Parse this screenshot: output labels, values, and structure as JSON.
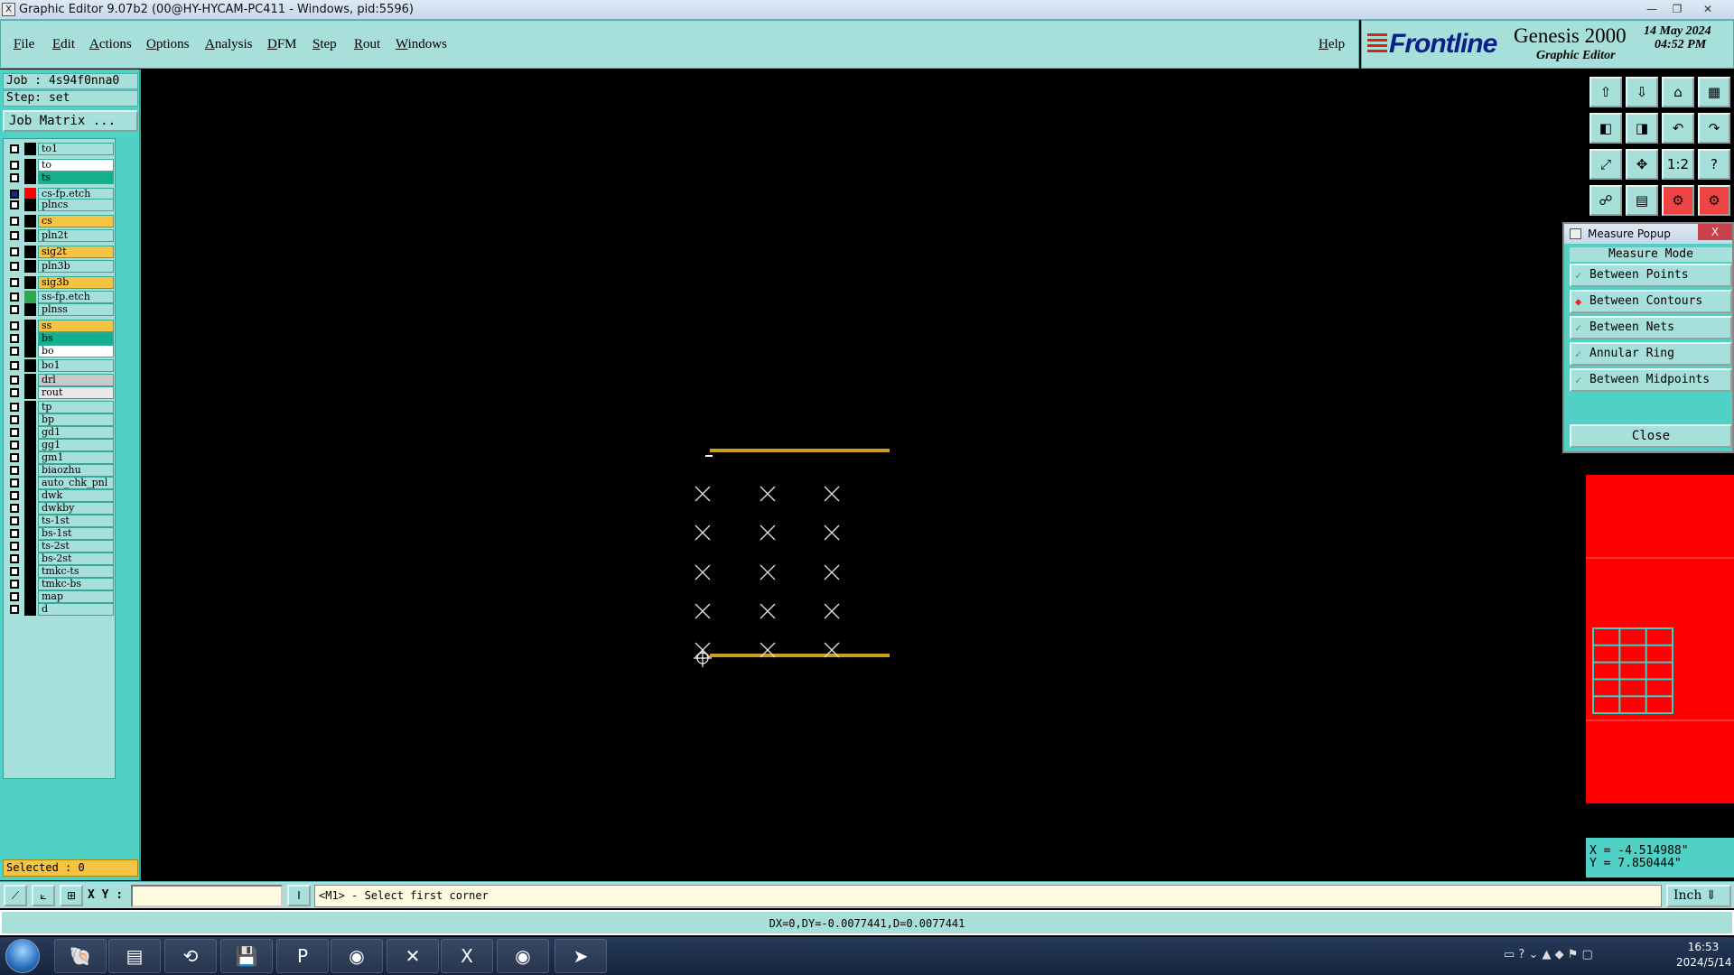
{
  "window": {
    "title": "Graphic Editor 9.07b2 (00@HY-HYCAM-PC411 - Windows, pid:5596)",
    "app_icon": "X"
  },
  "menu": {
    "items": [
      "File",
      "Edit",
      "Actions",
      "Options",
      "Analysis",
      "DFM",
      "Step",
      "Rout",
      "Windows"
    ],
    "help": "Help"
  },
  "brand": {
    "logo": "Frontline",
    "product": "Genesis 2000",
    "subtitle": "Graphic Editor",
    "date": "14 May 2024",
    "time": "04:52 PM"
  },
  "job": {
    "job_line": "Job : 4s94f0nna0",
    "step_line": "Step: set",
    "job_matrix_button": "Job Matrix ..."
  },
  "layers": [
    {
      "name": "to1",
      "color": "#a7dfdb",
      "swatch": "#000000"
    },
    {
      "name": "to",
      "color": "#ffffff",
      "swatch": "#000000"
    },
    {
      "name": "ts",
      "color": "#12b08c",
      "swatch": "#000000"
    },
    {
      "name": "cs-fp.etch",
      "color": "#a7dfdb",
      "swatch": "#ff0000",
      "marker": true
    },
    {
      "name": "plncs",
      "color": "#a7dfdb",
      "swatch": "#000000"
    },
    {
      "name": "cs",
      "color": "#f6c342",
      "swatch": "#000000"
    },
    {
      "name": "pln2t",
      "color": "#a7dfdb",
      "swatch": "#000000"
    },
    {
      "name": "sig2t",
      "color": "#f6c342",
      "swatch": "#000000"
    },
    {
      "name": "pln3b",
      "color": "#a7dfdb",
      "swatch": "#000000"
    },
    {
      "name": "sig3b",
      "color": "#f6c342",
      "swatch": "#000000"
    },
    {
      "name": "ss-fp.etch",
      "color": "#a7dfdb",
      "swatch": "#2fa84f"
    },
    {
      "name": "plnss",
      "color": "#a7dfdb",
      "swatch": "#000000"
    },
    {
      "name": "ss",
      "color": "#f6c342",
      "swatch": "#000000"
    },
    {
      "name": "bs",
      "color": "#12b08c",
      "swatch": "#000000"
    },
    {
      "name": "bo",
      "color": "#ffffff",
      "swatch": "#000000"
    },
    {
      "name": "bo1",
      "color": "#a7dfdb",
      "swatch": "#000000"
    },
    {
      "name": "drl",
      "color": "#c9c9c9",
      "swatch": "#000000"
    },
    {
      "name": "rout",
      "color": "#e8e8e8",
      "swatch": "#000000"
    },
    {
      "name": "tp",
      "color": "#a7dfdb",
      "swatch": "#000000"
    },
    {
      "name": "bp",
      "color": "#a7dfdb",
      "swatch": "#000000"
    },
    {
      "name": "gd1",
      "color": "#a7dfdb",
      "swatch": "#000000"
    },
    {
      "name": "gg1",
      "color": "#a7dfdb",
      "swatch": "#000000"
    },
    {
      "name": "gm1",
      "color": "#a7dfdb",
      "swatch": "#000000"
    },
    {
      "name": "biaozhu",
      "color": "#a7dfdb",
      "swatch": "#000000"
    },
    {
      "name": "auto_chk_pnl",
      "color": "#a7dfdb",
      "swatch": "#000000"
    },
    {
      "name": "dwk",
      "color": "#a7dfdb",
      "swatch": "#000000"
    },
    {
      "name": "dwkby",
      "color": "#a7dfdb",
      "swatch": "#000000"
    },
    {
      "name": "ts-1st",
      "color": "#a7dfdb",
      "swatch": "#000000"
    },
    {
      "name": "bs-1st",
      "color": "#a7dfdb",
      "swatch": "#000000"
    },
    {
      "name": "ts-2st",
      "color": "#a7dfdb",
      "swatch": "#000000"
    },
    {
      "name": "bs-2st",
      "color": "#a7dfdb",
      "swatch": "#000000"
    },
    {
      "name": "tmkc-ts",
      "color": "#a7dfdb",
      "swatch": "#000000"
    },
    {
      "name": "tmkc-bs",
      "color": "#a7dfdb",
      "swatch": "#000000"
    },
    {
      "name": "map",
      "color": "#a7dfdb",
      "swatch": "#000000"
    },
    {
      "name": "d",
      "color": "#a7dfdb",
      "swatch": "#000000"
    }
  ],
  "selected": "Selected : 0",
  "toolbar": {
    "icons": [
      "open-job-icon",
      "save-icon",
      "home-icon",
      "layout-icon",
      "prev-icon",
      "next-icon",
      "undo-icon",
      "redo-icon",
      "zoom-fit-icon",
      "zoom-home-icon",
      "one-to-one-icon",
      "help-icon",
      "snap-icon",
      "grid-icon",
      "measure-icon",
      "measure-active-icon"
    ],
    "glyphs": [
      "⇧",
      "⇩",
      "⌂",
      "▦",
      "◧",
      "◨",
      "↶",
      "↷",
      "⤢",
      "✥",
      "1:2",
      "?",
      "☍",
      "▤",
      "⚙",
      "⚙"
    ]
  },
  "measure_popup": {
    "title": "Measure Popup",
    "close_x": "X",
    "mode_title": "Measure Mode",
    "options": [
      {
        "label": "Between Points",
        "selected": false
      },
      {
        "label": "Between Contours",
        "selected": true
      },
      {
        "label": "Between Nets",
        "selected": false
      },
      {
        "label": "Annular Ring",
        "selected": false
      },
      {
        "label": "Between Midpoints",
        "selected": false
      }
    ],
    "close_button": "Close"
  },
  "coords": {
    "x": "X = -4.514988\"",
    "y": "Y = 7.850444\""
  },
  "command": {
    "xy_label": "X Y :",
    "xy_value": "",
    "prompt": "<M1> - Select first corner",
    "units": "Inch"
  },
  "status": {
    "measurement": "DX=0,DY=-0.0077441,D=0.0077441"
  },
  "taskbar": {
    "apps": [
      "shell-icon",
      "notes-icon",
      "app-icon",
      "save-icon",
      "p-app-icon",
      "eye-app-icon",
      "x-app-icon",
      "excel-icon",
      "eye-app2-icon",
      "arrow-app-icon"
    ],
    "glyphs": [
      "🐚",
      "▤",
      "⟲",
      "💾",
      "P",
      "◉",
      "✕",
      "X",
      "◉",
      "➤"
    ],
    "clock_time": "16:53",
    "clock_date": "2024/5/14"
  }
}
